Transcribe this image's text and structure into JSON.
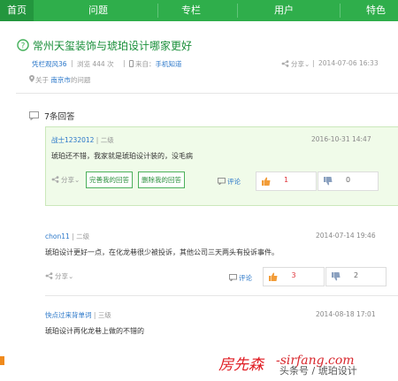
{
  "nav": {
    "items": [
      "首页",
      "问题",
      "专栏",
      "用户",
      "特色"
    ],
    "active_index": 0,
    "color": "#2fae4b"
  },
  "question": {
    "title": "常州天玺装饰与琥珀设计哪家更好",
    "author": "凭栏观风36",
    "views": "浏览 444 次",
    "source_prefix": "来自：",
    "source": "手机知道",
    "share": "分享",
    "date": "2014-07-06 16:33",
    "location_prefix": "关于",
    "location": "南京市",
    "location_suffix": "的问题"
  },
  "answers_header": "7条回答",
  "answers": [
    {
      "user": "战士1232012",
      "level": "二级",
      "date": "2016-10-31 14:47",
      "content": "琥珀还不错，我家就是琥珀设计装的，没毛病",
      "share": "分享",
      "buttons": [
        "完善我的回答",
        "删除我的回答"
      ],
      "comment": "评论",
      "up": "1",
      "down": "0"
    },
    {
      "user": "chon11",
      "level": "二级",
      "date": "2014-07-14 19:46",
      "content": "琥珀设计更好一点，在化龙巷很少被投诉，其他公司三天两头有投诉事件。",
      "share": "分享",
      "comment": "评论",
      "up": "3",
      "down": "2"
    },
    {
      "user": "快点过来背单词",
      "level": "三级",
      "date": "2014-08-18 17:01",
      "content": "琥珀设计再化龙巷上做的不错的"
    }
  ],
  "watermark": {
    "brand": "房先森",
    "site": "-sirfang.com",
    "sub": "头条号 / 琥珀设计"
  }
}
